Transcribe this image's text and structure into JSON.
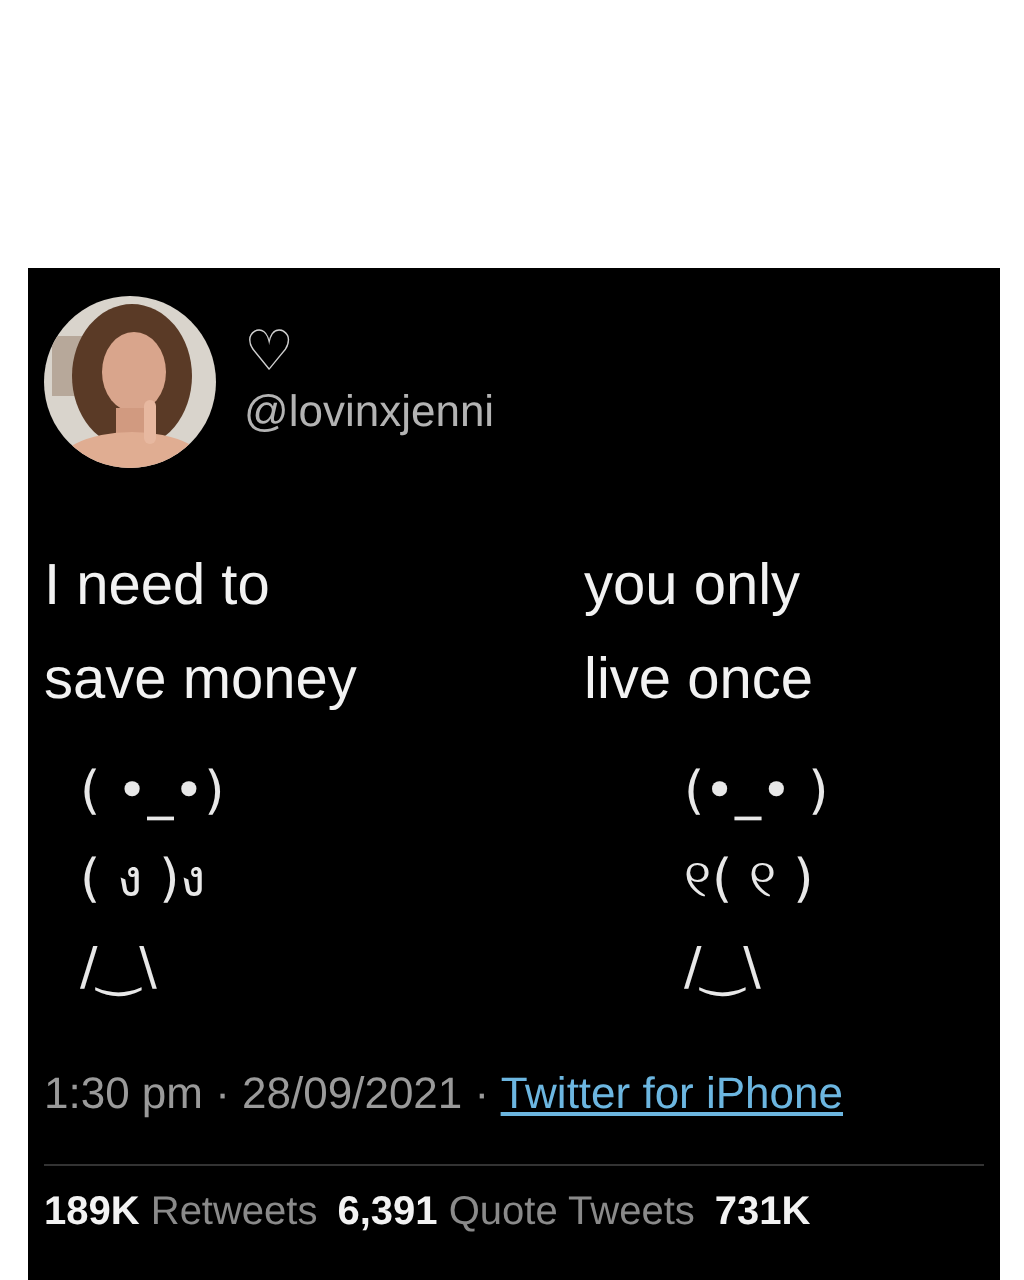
{
  "tweet": {
    "author": {
      "heart": "♡",
      "handle": "@lovinxjenni"
    },
    "columns": [
      {
        "lines": [
          "I need to",
          "save money"
        ],
        "kaomoji": [
          "( •_•)",
          "( ง )ง",
          "/‿\\"
        ]
      },
      {
        "lines": [
          "you only",
          "live once"
        ],
        "kaomoji": [
          "(•_• )",
          "୧( ୧ )",
          "/‿\\"
        ]
      }
    ],
    "timestamp": "1:30 pm · 28/09/2021 ·",
    "source": "Twitter for iPhone",
    "stats": [
      {
        "count": "189K",
        "label": "Retweets"
      },
      {
        "count": "6,391",
        "label": "Quote Tweets"
      },
      {
        "count": "731K"
      }
    ]
  }
}
